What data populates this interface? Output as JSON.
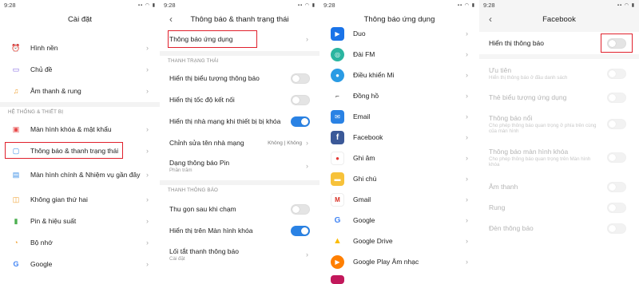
{
  "status": {
    "time": "9:28",
    "icons": "▪▪ ◠ ▮"
  },
  "screen1": {
    "title": "Cài đặt",
    "items_top": [
      "Hình nền",
      "Chủ đề",
      "Âm thanh & rung"
    ],
    "section": "HỆ THỐNG & THIẾT BỊ",
    "items": [
      "Màn hình khóa & mật khẩu",
      "Thông báo & thanh trạng thái",
      "Màn hình chính & Nhiệm vụ gần đây",
      "Không gian thứ hai",
      "Pin & hiệu suất",
      "Bộ nhớ",
      "Google"
    ]
  },
  "screen2": {
    "title": "Thông báo & thanh trạng thái",
    "app_notifications": "Thông báo ứng dụng",
    "section_status": "THANH TRẠNG THÁI",
    "show_notif_icons": "Hiển thị biểu tượng thông báo",
    "show_speed": "Hiển thị tốc độ kết nối",
    "show_carrier": "Hiển thị nhà mạng khi thiết bị bị khóa",
    "edit_carrier": "Chỉnh sửa tên nhà mạng",
    "edit_carrier_value": "Không | Không",
    "battery_style": "Dạng thông báo Pin",
    "battery_style_value": "Phần trăm",
    "section_shade": "THANH THÔNG BÁO",
    "collapse_after_touch": "Thu gọn sau khi chạm",
    "show_on_lock": "Hiển thị trên Màn hình khóa",
    "shade_layout": "Lối tắt thanh thông báo",
    "shade_layout_value": "Cài đặt"
  },
  "screen3": {
    "title": "Thông báo ứng dụng",
    "apps": [
      "Duo",
      "Đài FM",
      "Điều khiển Mi",
      "Đồng hồ",
      "Email",
      "Facebook",
      "Ghi âm",
      "Ghi chú",
      "Gmail",
      "Google",
      "Google Drive",
      "Google Play Âm nhạc"
    ]
  },
  "screen4": {
    "title": "Facebook",
    "show_notifications": "Hiển thị thông báo",
    "priority": "Ưu tiên",
    "priority_sub": "Hiển thị thông báo ở đầu danh sách",
    "badge": "Thẻ biểu tượng ứng dụng",
    "floating": "Thông báo nổi",
    "floating_sub": "Cho phép thông báo quan trọng ở phía trên cùng của màn hình",
    "lockscreen": "Thông báo màn hình khóa",
    "lockscreen_sub": "Cho phép thông báo quan trọng trên Màn hình khóa",
    "sound": "Âm thanh",
    "vibrate": "Rung",
    "light": "Đèn thông báo"
  }
}
